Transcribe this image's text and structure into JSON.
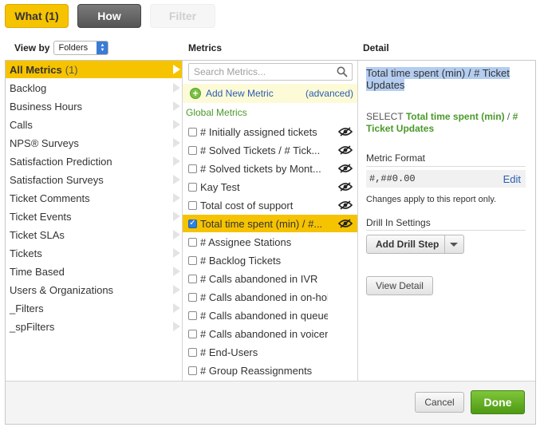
{
  "tabs": {
    "what": "What (1)",
    "how": "How",
    "filter": "Filter"
  },
  "headers": {
    "view_by": "View by",
    "view_by_value": "Folders",
    "metrics": "Metrics",
    "detail": "Detail"
  },
  "folders": [
    {
      "label": "All Metrics",
      "count": "(1)",
      "active": true
    },
    {
      "label": "Backlog"
    },
    {
      "label": "Business Hours"
    },
    {
      "label": "Calls"
    },
    {
      "label": "NPS® Surveys"
    },
    {
      "label": "Satisfaction Prediction"
    },
    {
      "label": "Satisfaction Surveys"
    },
    {
      "label": "Ticket Comments"
    },
    {
      "label": "Ticket Events"
    },
    {
      "label": "Ticket SLAs"
    },
    {
      "label": "Tickets"
    },
    {
      "label": "Time Based"
    },
    {
      "label": "Users & Organizations"
    },
    {
      "label": "_Filters"
    },
    {
      "label": "_spFilters"
    }
  ],
  "metrics": {
    "search_placeholder": "Search Metrics...",
    "add_new": "Add New Metric",
    "advanced": "(advanced)",
    "section": "Global Metrics",
    "items": [
      {
        "label": "# Initially assigned tickets",
        "hidden": true,
        "checked": false
      },
      {
        "label": "# Solved Tickets / # Tick...",
        "hidden": true,
        "checked": false
      },
      {
        "label": "# Solved tickets by Mont...",
        "hidden": true,
        "checked": false
      },
      {
        "label": "Kay Test",
        "hidden": true,
        "checked": false
      },
      {
        "label": "Total cost of support",
        "hidden": true,
        "checked": false
      },
      {
        "label": "Total time spent (min) / #...",
        "hidden": true,
        "checked": true
      },
      {
        "label": "# Assignee Stations",
        "hidden": false,
        "checked": false
      },
      {
        "label": "# Backlog Tickets",
        "hidden": false,
        "checked": false
      },
      {
        "label": "# Calls abandoned in IVR",
        "hidden": false,
        "checked": false
      },
      {
        "label": "# Calls abandoned in on-hold",
        "hidden": false,
        "checked": false
      },
      {
        "label": "# Calls abandoned in queue",
        "hidden": false,
        "checked": false
      },
      {
        "label": "# Calls abandoned in voicemail",
        "hidden": false,
        "checked": false
      },
      {
        "label": "# End-Users",
        "hidden": false,
        "checked": false
      },
      {
        "label": "# Group Reassignments",
        "hidden": false,
        "checked": false
      }
    ]
  },
  "detail": {
    "title_line1": "Total time spent (min) / # Ticket",
    "title_line2": "Updates",
    "select_prefix": "SELECT ",
    "select_metric_a": "Total time spent (min)",
    "select_sep": " / ",
    "select_metric_b": "# Ticket Updates",
    "format_label": "Metric Format",
    "format_value": "#,##0.00",
    "edit_label": "Edit",
    "note": "Changes apply to this report only.",
    "drill_label": "Drill In Settings",
    "add_drill_step": "Add Drill Step",
    "view_detail": "View Detail"
  },
  "footer": {
    "cancel": "Cancel",
    "done": "Done"
  },
  "colors": {
    "accent": "#f6c300",
    "done_green": "#5aa81e",
    "link_blue": "#2a5db0",
    "metric_green": "#4a9a2a"
  }
}
